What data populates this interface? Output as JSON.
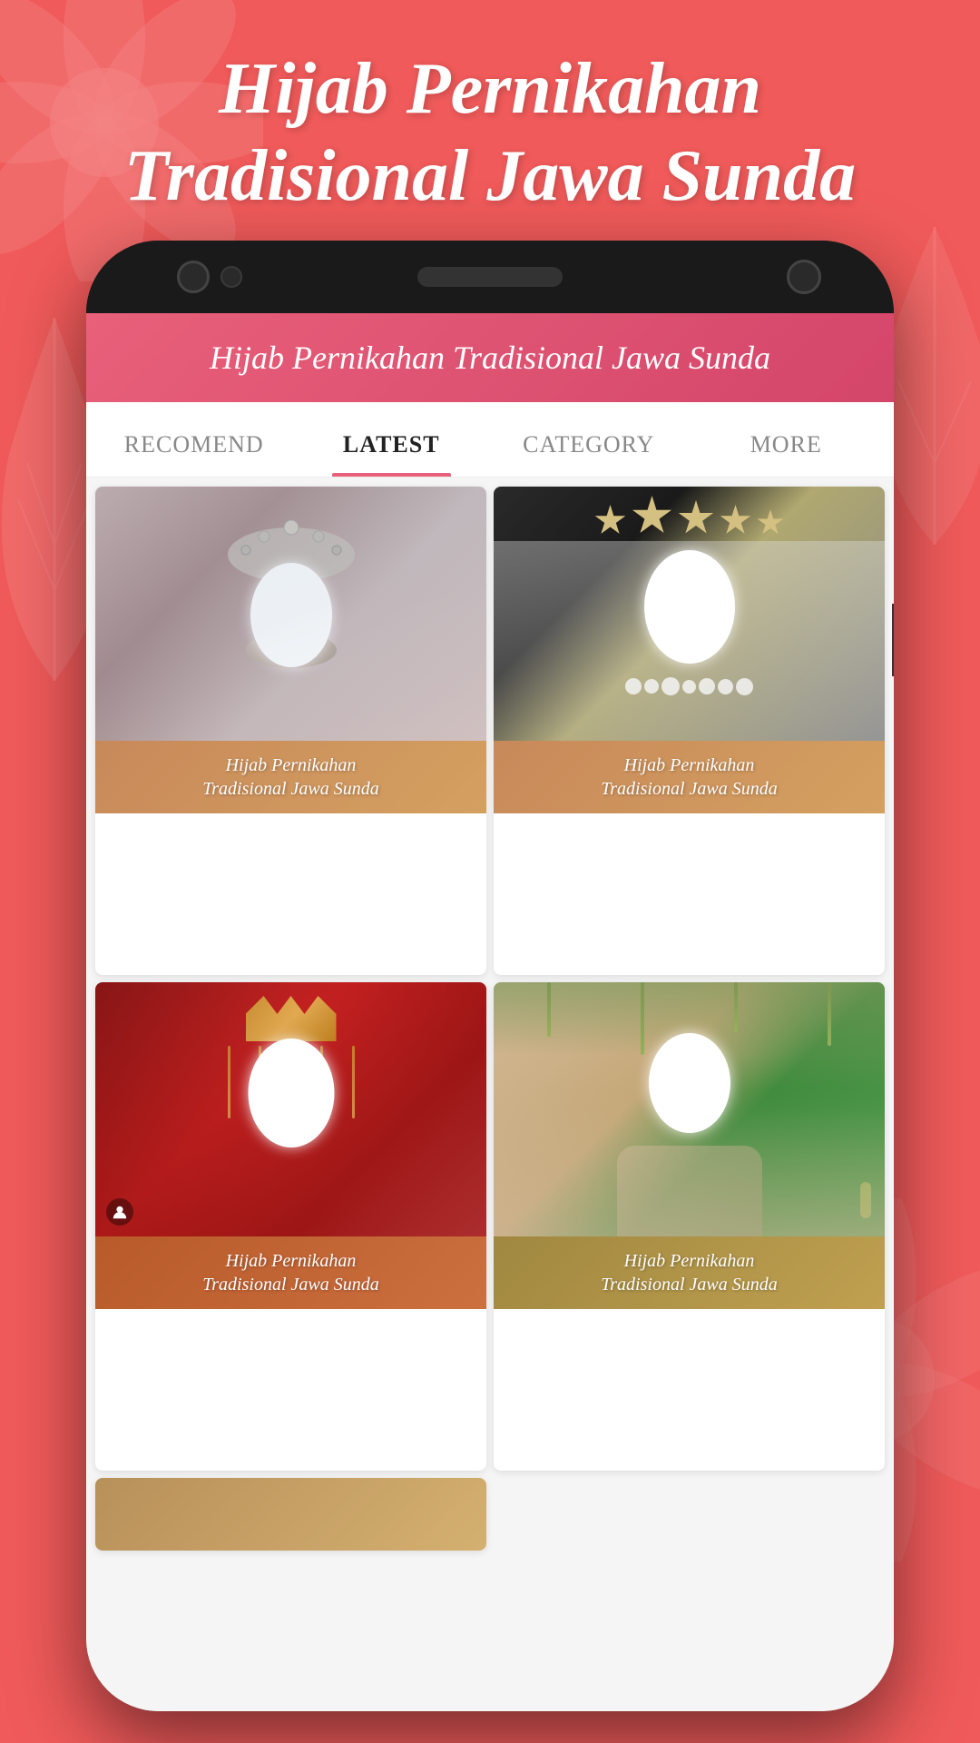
{
  "app": {
    "title": "Hijab Pernikahan Tradisional Jawa Sunda",
    "background_color": "#f05a5a",
    "accent_color": "#e8607a"
  },
  "hero": {
    "title_line1": "Hijab Pernikahan",
    "title_line2": "Tradisional Jawa Sunda"
  },
  "tabs": [
    {
      "id": "recomend",
      "label": "RECOMEND",
      "active": false
    },
    {
      "id": "latest",
      "label": "LATEST",
      "active": true
    },
    {
      "id": "category",
      "label": "CATEGORY",
      "active": false
    },
    {
      "id": "more",
      "label": "MORE",
      "active": false
    }
  ],
  "cards": [
    {
      "id": 1,
      "label": "Hijab Pernikahan\nTradisional Jawa Sunda",
      "style": "silver-blue"
    },
    {
      "id": 2,
      "label": "Hijab Pernikahan\nTradisional Jawa Sunda",
      "style": "black-flowers"
    },
    {
      "id": 3,
      "label": "Hijab Pernikahan\nTradisional Jawa Sunda",
      "style": "red-crown"
    },
    {
      "id": 4,
      "label": "Hijab Pernikahan\nTradisional Jawa Sunda",
      "style": "beige-garden"
    }
  ],
  "card_label": "Hijab Pernikahan Tradisional Jawa Sunda"
}
